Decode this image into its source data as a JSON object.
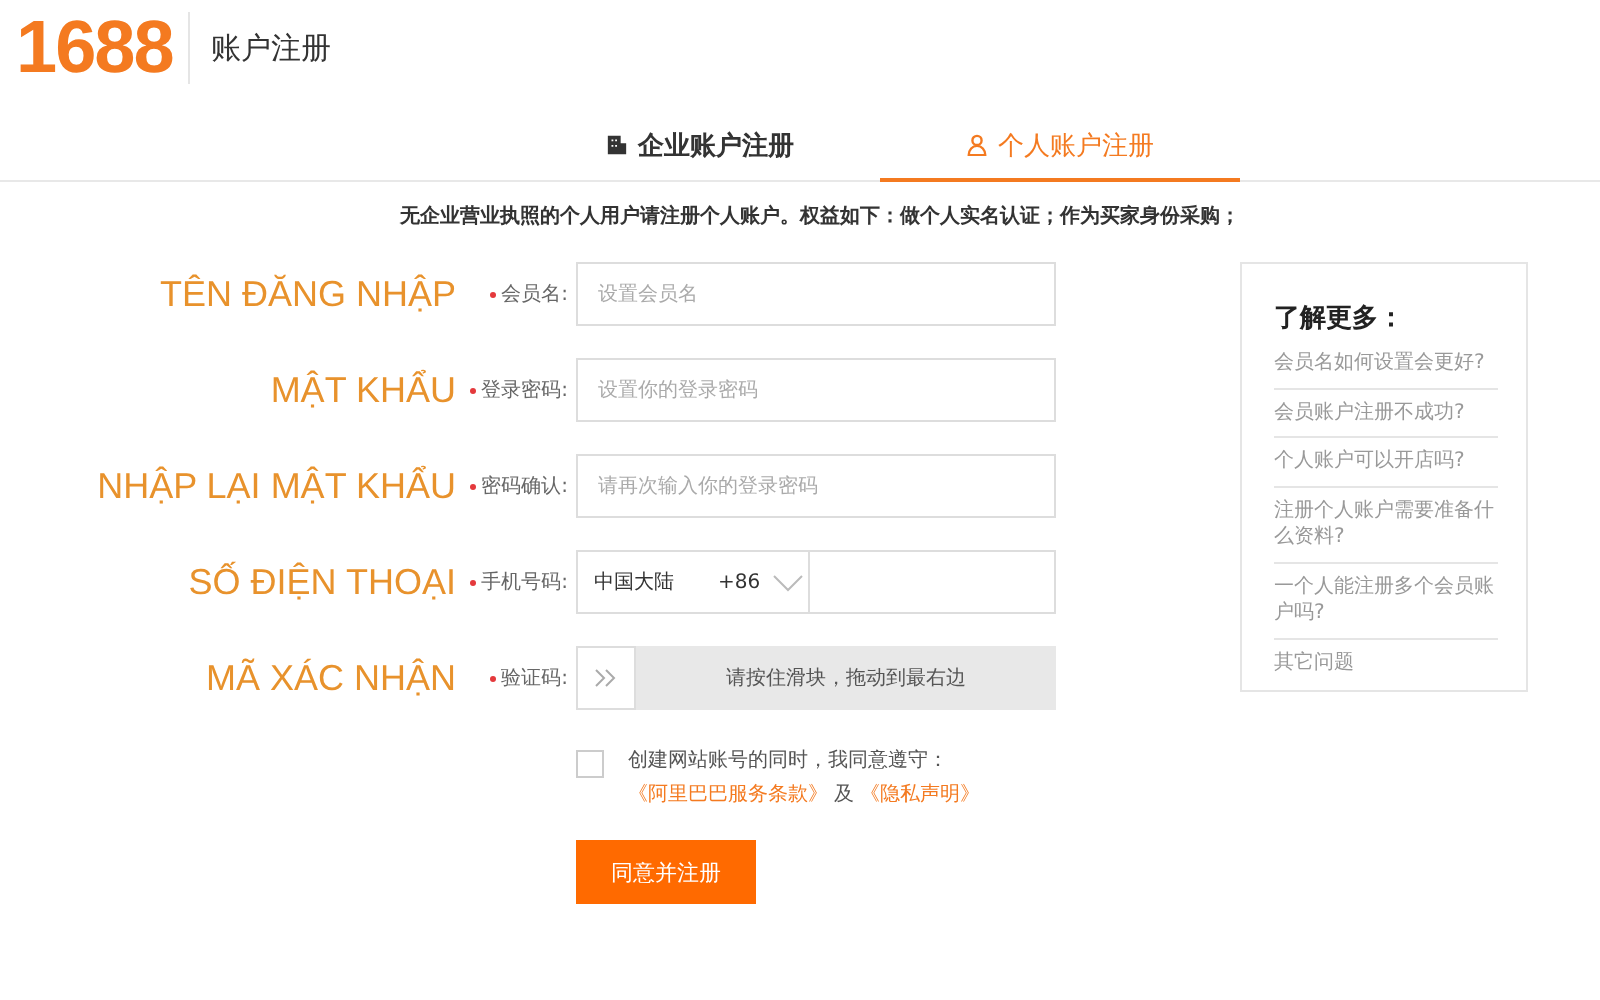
{
  "header": {
    "logo": "1688",
    "title": "账户注册"
  },
  "tabs": [
    {
      "label": "企业账户注册",
      "kind": "business",
      "selected": false
    },
    {
      "label": "个人账户注册",
      "kind": "personal",
      "selected": true
    }
  ],
  "notice": "无企业营业执照的个人用户请注册个人账户。权益如下：做个人实名认证；作为买家身份采购；",
  "fields": [
    {
      "kind": "text",
      "annotation": "TÊN ĐĂNG NHẬP",
      "required": true,
      "label": "会员名:",
      "placeholder": "设置会员名"
    },
    {
      "kind": "text",
      "annotation": "MẬT KHẨU",
      "required": true,
      "label": "登录密码:",
      "placeholder": "设置你的登录密码"
    },
    {
      "kind": "text",
      "annotation": "NHẬP LẠI MẬT KHẨU",
      "required": true,
      "label": "密码确认:",
      "placeholder": "请再次输入你的登录密码"
    },
    {
      "kind": "phone",
      "annotation": "SỐ ĐIỆN THOẠI",
      "required": true,
      "label": "手机号码:",
      "region": "中国大陆",
      "code": "+86"
    },
    {
      "kind": "slider",
      "annotation": "MÃ XÁC NHẬN",
      "required": true,
      "label": "验证码:",
      "hint": "请按住滑块，拖动到最右边"
    }
  ],
  "agreement": {
    "checked": false,
    "text": "创建网站账号的同时，我同意遵守：",
    "link_1": "《阿里巴巴服务条款》",
    "joiner": "及",
    "link_2": "《隐私声明》"
  },
  "submit": "同意并注册",
  "sidebar": {
    "title": "了解更多：",
    "items": [
      "会员名如何设置会更好?",
      "会员账户注册不成功?",
      "个人账户可以开店吗?",
      "注册个人账户需要准备什么资料?",
      "一个人能注册多个会员账户吗?",
      "其它问题"
    ]
  }
}
